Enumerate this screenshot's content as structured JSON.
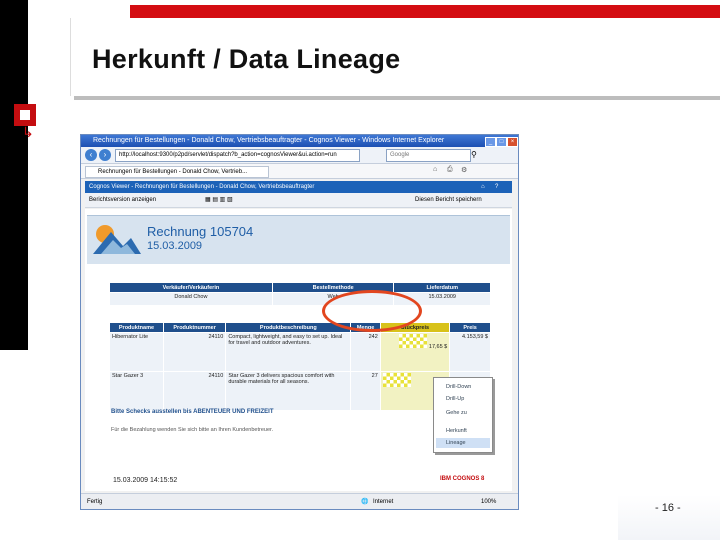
{
  "slide": {
    "title": "Herkunft / Data Lineage",
    "page_number": "- 16 -"
  },
  "browser": {
    "window_title": "Rechnungen für Bestellungen - Donald Chow, Vertriebsbeauftragter - Cognos Viewer - Windows Internet Explorer",
    "url": "http://localhost:9300/p2pd/servlet/dispatch?b_action=cognosViewer&ui.action=run",
    "search_placeholder": "Google",
    "tab_label": "Rechnungen für Bestellungen - Donald Chow, Vertrieb...",
    "cognos_header": "Cognos Viewer - Rechnungen für Bestellungen - Donald Chow, Vertriebsbeauftragter",
    "toolbar_left": "Berichtsversion anzeigen",
    "toolbar_right": "Diesen Bericht speichern",
    "status_left": "Fertig",
    "status_zone": "Internet",
    "status_zoom": "100%"
  },
  "report": {
    "title": "Rechnung 105704",
    "date": "15.03.2009",
    "vendor_table": {
      "headers": [
        "Verkäufer/Verkäuferin",
        "Bestellmethode",
        "Lieferdatum"
      ],
      "row": [
        "Donald Chow",
        "Web",
        "15.03.2009"
      ]
    },
    "products_table": {
      "headers": [
        "Produktname",
        "Produktnummer",
        "Produktbeschreibung",
        "Menge",
        "Stückpreis",
        "Preis"
      ],
      "rows": [
        [
          "Hibernator Lite",
          "24110",
          "Compact, lightweight, and easy to set up. Ideal for travel and outdoor adventures.",
          "242",
          "17,65 $",
          "4.153,59 $"
        ],
        [
          "Star Gazer 3",
          "24110",
          "Star Gazer 3 delivers spacious comfort with durable materials for all seasons.",
          "27",
          "",
          ""
        ]
      ]
    },
    "summary_line": "Bitte Schecks ausstellen bis ABENTEUER UND FREIZEIT",
    "footer_note": "Für die Bezahlung wenden Sie sich bitte an Ihren Kundenbetreuer.",
    "datetime": "15.03.2009 14:15:52",
    "ibm_logo": "IBM COGNOS 8"
  },
  "context_menu": {
    "items": [
      "Drill-Down",
      "Drill-Up",
      "Gehe zu",
      "Herkunft",
      "Lineage"
    ]
  }
}
